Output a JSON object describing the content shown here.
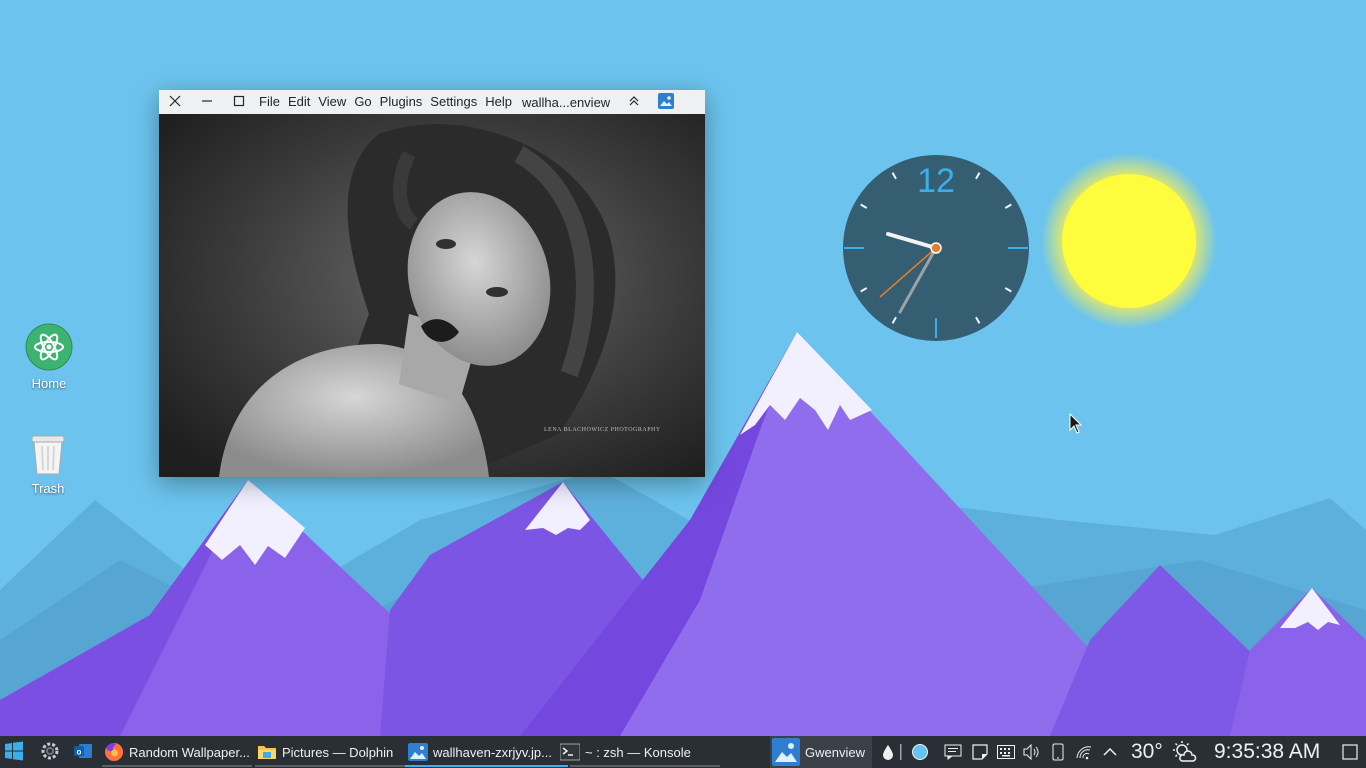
{
  "desktop": {
    "icons": [
      {
        "label": "Home",
        "icon": "atom-home-icon"
      },
      {
        "label": "Trash",
        "icon": "trash-icon"
      }
    ],
    "colors": {
      "sky": "#6cc4ee",
      "mountain_purple": "#8a63ea",
      "mountain_dark": "#7048de",
      "snow": "#f2f0ff"
    }
  },
  "window": {
    "app": "Gwenview",
    "menu": [
      "File",
      "Edit",
      "View",
      "Go",
      "Plugins",
      "Settings",
      "Help"
    ],
    "title": "wallha...enview",
    "photo_watermark": "LENA BLACHOWICZ PHOTOGRAPHY"
  },
  "clock_widget": {
    "number": "12",
    "time_shown": "9:35:38"
  },
  "weather_widget": {
    "condition": "sunny"
  },
  "taskbar": {
    "start_icon": "windows-start-icon",
    "tasks": [
      {
        "label": "Random Wallpaper...",
        "icon": "firefox-icon"
      },
      {
        "label": "Pictures — Dolphin",
        "icon": "folder-icon"
      },
      {
        "label": "wallhaven-zxrjyv.jp...",
        "icon": "image-icon",
        "active": true
      },
      {
        "label": "~ : zsh — Konsole",
        "icon": "terminal-icon"
      }
    ],
    "gwenview_label": "Gwenview",
    "temperature": "30°",
    "clock": "9:35:38 AM",
    "colors": {
      "bg": "#2a2e35",
      "accent": "#3daee9",
      "inactive_line": "#5b5f66"
    }
  }
}
